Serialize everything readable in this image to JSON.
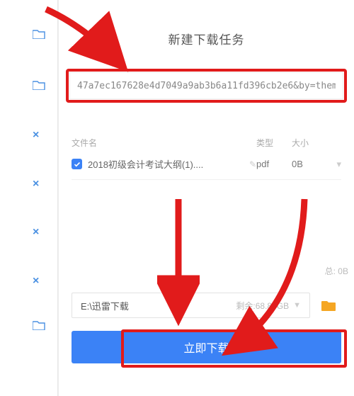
{
  "dialog": {
    "title": "新建下载任务",
    "url": "47a7ec167628e4d7049a9ab3b6a11fd396cb2e6&by=them",
    "table": {
      "header": {
        "filename": "文件名",
        "type": "类型",
        "size": "大小"
      },
      "rows": [
        {
          "checked": true,
          "name": "2018初级会计考试大纲(1)....",
          "type": "pdf",
          "size": "0B"
        }
      ]
    },
    "total_label": "总: 0B",
    "path": {
      "value": "E:\\迅雷下载",
      "remaining_label": "剩余:",
      "remaining_value": "68.87GB"
    },
    "download_btn": "立即下载"
  },
  "colors": {
    "red": "#e11b1b",
    "blue": "#3b82f6",
    "folder_orange": "#f5a623",
    "folder_blue": "#4a90e2"
  }
}
